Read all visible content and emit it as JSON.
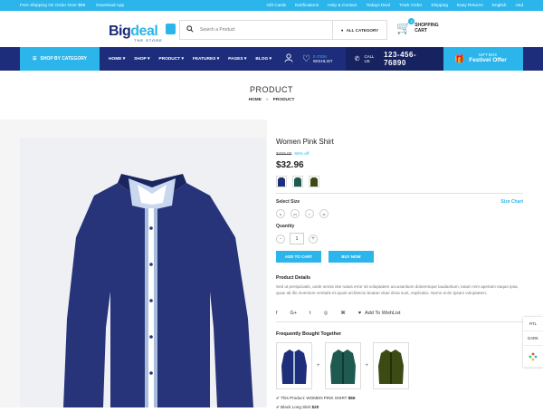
{
  "topbar": {
    "left": [
      "Free Shipping On Order Over $99",
      "Download App"
    ],
    "right": [
      "Gift Cards",
      "Notifications",
      "Help & Contact",
      "Todays Deal",
      "Track Order",
      "Shipping",
      "Easy Returns",
      "English",
      "Usd"
    ]
  },
  "logo": {
    "part1": "Big",
    "part2": "deal",
    "sub": "THE STORE"
  },
  "search": {
    "placeholder": "Search a Product",
    "category": "ALL CATEGORY"
  },
  "cart": {
    "count": "0",
    "line1": "SHOPPING",
    "line2": "CART"
  },
  "nav": {
    "shop_by": "SHOP BY CATEGORY",
    "items": [
      "HOME",
      "SHOP",
      "PRODUCT",
      "FEATURES",
      "PAGES",
      "BLOG"
    ],
    "wish_count": "0 ITEM",
    "wish_label": "WISHLIST",
    "call_label": "CALL US",
    "phone": "123-456-76890",
    "gift_line1": "GIFT BOX",
    "gift_line2": "Festivel Offer"
  },
  "page": {
    "title": "PRODUCT",
    "crumb_home": "HOME",
    "crumb_current": "PRODUCT"
  },
  "product": {
    "name": "Women Pink Shirt",
    "old_price": "$459.00",
    "discount": "55% off",
    "price": "$32.96",
    "select_size": "Select Size",
    "size_chart": "Size Chart",
    "sizes": [
      "s",
      "m",
      "l",
      "xl"
    ],
    "quantity_label": "Quantity",
    "quantity": "1",
    "add_to_cart": "ADD TO CART",
    "buy_now": "BUY NOW",
    "details_title": "Product Details",
    "details": "Sed ut perspiciatis, unde omnis iste natus error sit voluptatem accusantium doloremque laudantium, totam rem aperiam eaque ipsa, quae ab illo inventore veritatis et quasi architecto beatae vitae dicta sunt, explicabo. Nemo enim ipsam voluptatem,",
    "social": [
      "f",
      "G+",
      "t",
      "◎",
      "⌘"
    ],
    "add_wishlist": "Add To WishList",
    "fbt_title": "Frequently Bought Together",
    "checks": [
      {
        "label": "This Product: WOMEN PINK SHIRT",
        "price": "$55"
      },
      {
        "label": "Black Long Skirt",
        "price": "$20"
      }
    ],
    "swatch_colors": [
      "#1f2e7a",
      "#1f5a50",
      "#3c4a14"
    ]
  },
  "side": {
    "rtl": "RTL",
    "dark": "DARK"
  },
  "colors": {
    "accent": "#2bb5ea",
    "navy": "#1d2d7c"
  }
}
